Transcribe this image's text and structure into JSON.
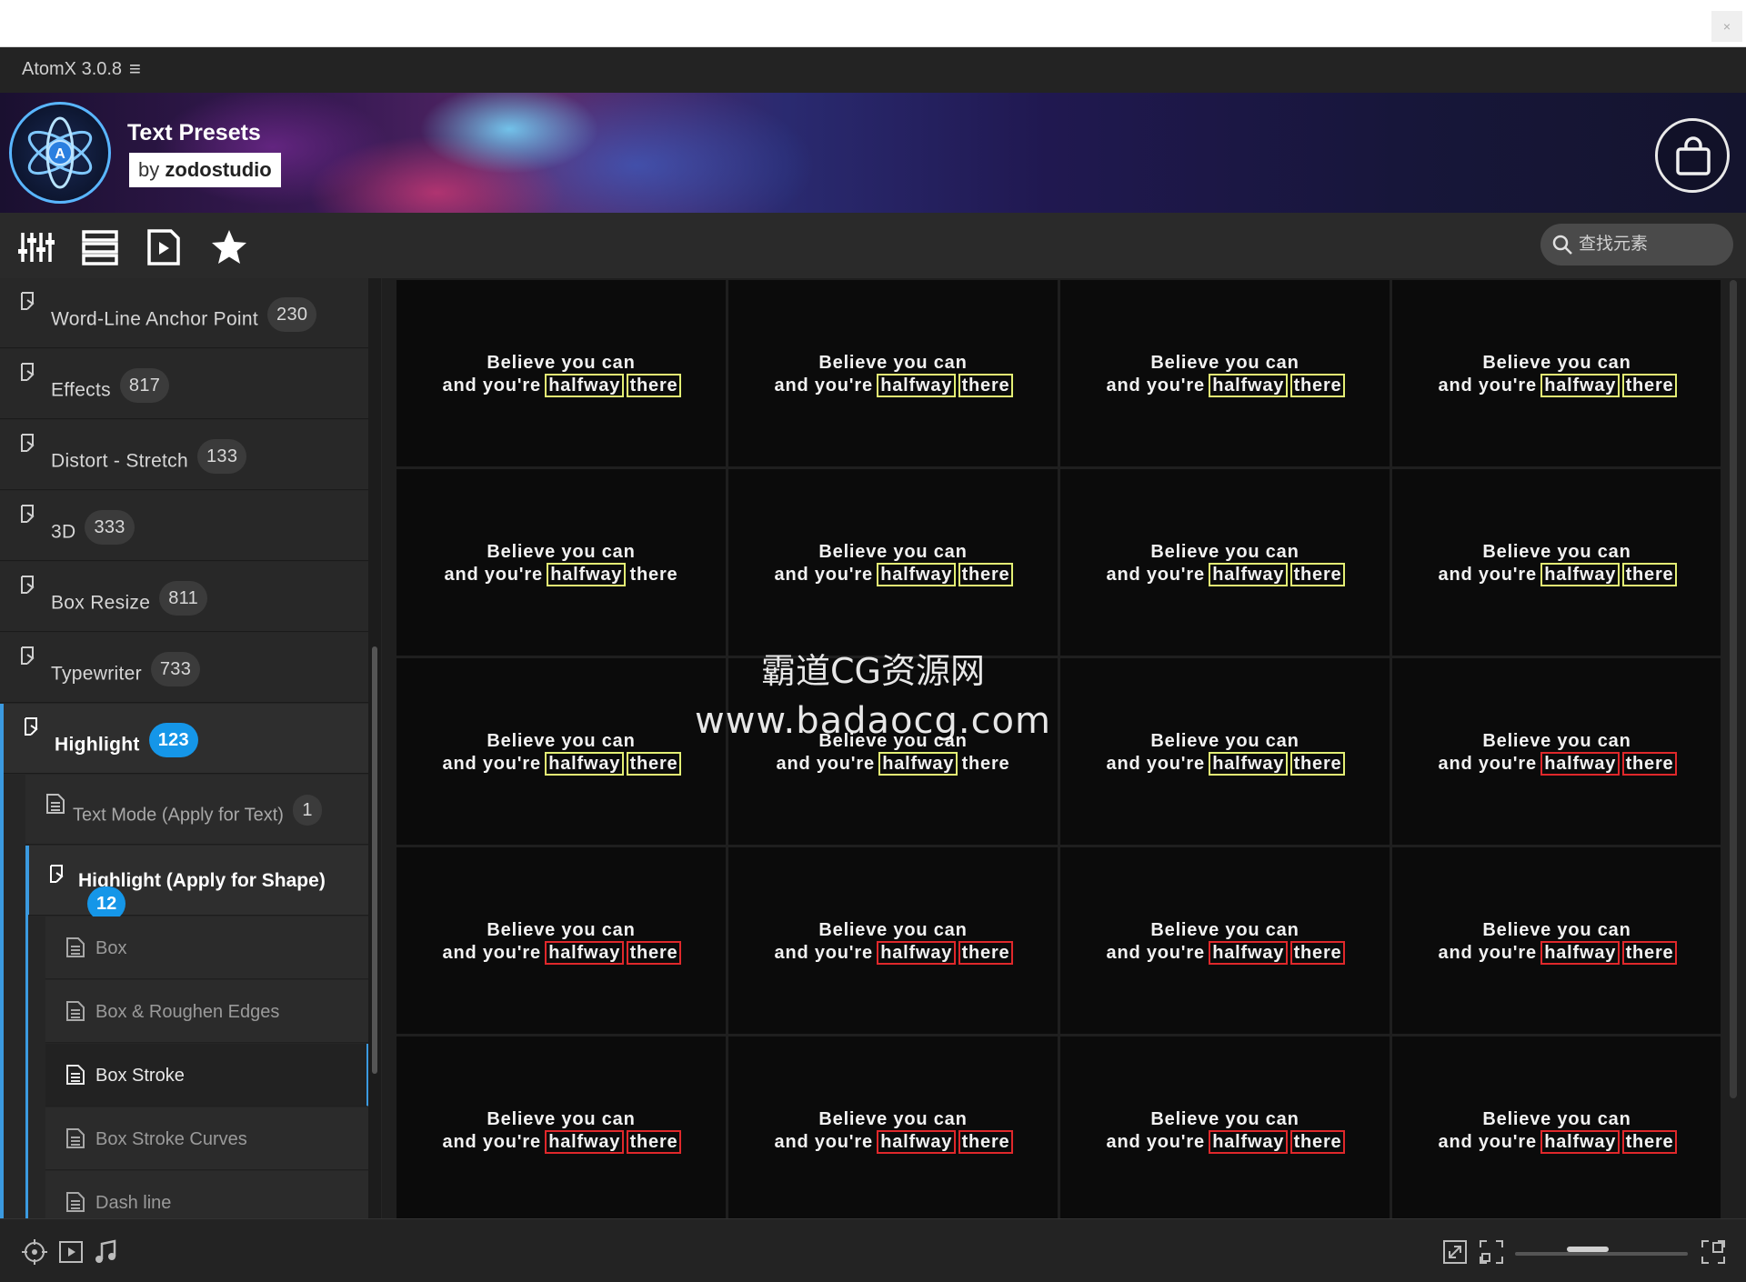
{
  "app": {
    "title": "AtomX 3.0.8",
    "menu_icon": "hamburger-icon"
  },
  "banner": {
    "title": "Text Presets",
    "by": "by",
    "author": "zodostudio"
  },
  "toolbar": {
    "tools": [
      "sliders-icon",
      "list-icon",
      "play-file-icon",
      "star-icon"
    ],
    "search_placeholder": "查找元素"
  },
  "sidebar": {
    "categories": [
      {
        "label": "Word-Line Anchor Point",
        "count": "230"
      },
      {
        "label": "Effects",
        "count": "817"
      },
      {
        "label": "Distort - Stretch",
        "count": "133"
      },
      {
        "label": "3D",
        "count": "333"
      },
      {
        "label": "Box Resize",
        "count": "811"
      },
      {
        "label": "Typewriter",
        "count": "733"
      },
      {
        "label": "Highlight",
        "count": "123"
      }
    ],
    "subcategories": [
      {
        "label": "Text Mode (Apply for Text)",
        "count": "1"
      },
      {
        "label": "Highlight (Apply for Shape)",
        "count": "12"
      }
    ],
    "items": [
      "Box",
      "Box & Roughen Edges",
      "Box Stroke",
      "Box Stroke Curves",
      "Dash line"
    ],
    "selected_item": "Box Stroke"
  },
  "preview": {
    "line1": "Believe you can",
    "prefix": "and you're",
    "word1": "halfway",
    "word2": "there",
    "highlight_colors": {
      "yellow": "#e3ef74",
      "red": "#e0282b"
    }
  },
  "watermark": {
    "line1": "霸道CG资源网",
    "line2": "www.badaocg.com"
  },
  "bottombar": {
    "icons": [
      "anchor-icon",
      "video-icon",
      "music-icon",
      "fit-icon",
      "fullscreen-icon",
      "grid-size-icon"
    ]
  }
}
